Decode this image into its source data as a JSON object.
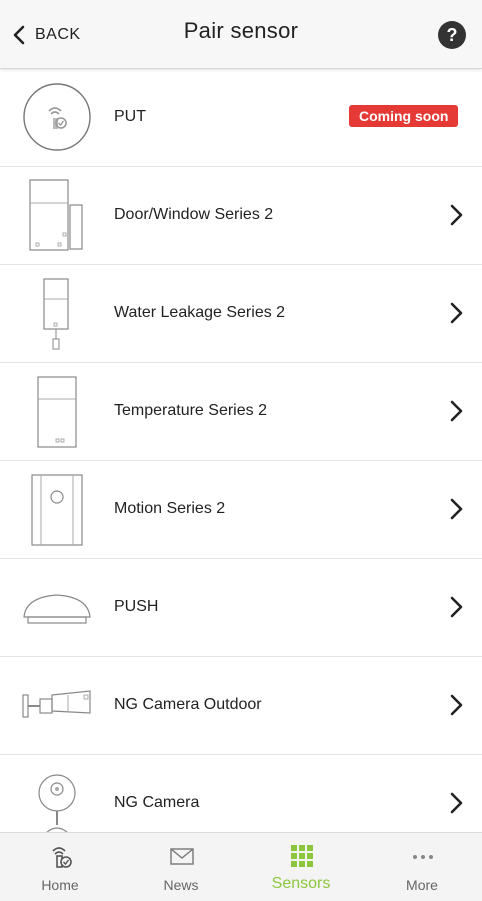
{
  "header": {
    "back_label": "BACK",
    "title": "Pair sensor",
    "help_label": "?"
  },
  "sensors": [
    {
      "label": "PUT",
      "icon": "put-sensor-icon",
      "badge": "Coming soon"
    },
    {
      "label": "Door/Window Series 2",
      "icon": "door-window-sensor-icon"
    },
    {
      "label": "Water Leakage Series 2",
      "icon": "water-leakage-sensor-icon"
    },
    {
      "label": "Temperature Series 2",
      "icon": "temperature-sensor-icon"
    },
    {
      "label": "Motion Series 2",
      "icon": "motion-sensor-icon"
    },
    {
      "label": "PUSH",
      "icon": "push-button-icon"
    },
    {
      "label": "NG Camera Outdoor",
      "icon": "outdoor-camera-icon"
    },
    {
      "label": "NG Camera",
      "icon": "indoor-camera-icon"
    }
  ],
  "tabbar": {
    "tabs": [
      {
        "label": "Home",
        "icon": "home-icon",
        "active": false
      },
      {
        "label": "News",
        "icon": "envelope-icon",
        "active": false
      },
      {
        "label": "Sensors",
        "icon": "grid-icon",
        "active": true
      },
      {
        "label": "More",
        "icon": "more-dots-icon",
        "active": false
      }
    ]
  },
  "colors": {
    "accent": "#8cc63f",
    "badge": "#e53935",
    "header_bg": "#f7f7f7",
    "tabbar_bg": "#f4f4f4"
  }
}
